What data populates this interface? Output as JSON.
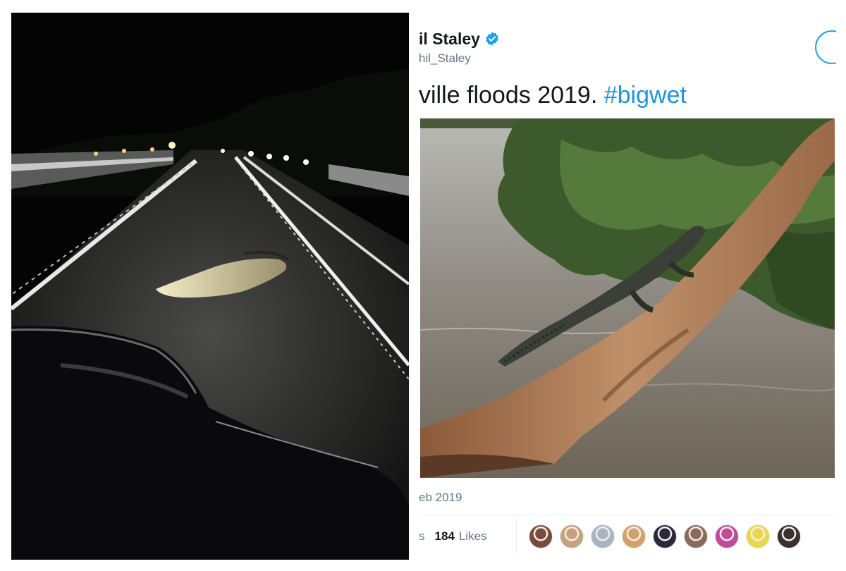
{
  "tweet": {
    "author_name": "il Staley",
    "handle": "hil_Staley",
    "text": "ville floods 2019. ",
    "hashtag": "#bigwet",
    "timestamp": "eb 2019",
    "stats_prefix": "s",
    "likes_count": "184",
    "likes_label": "Likes",
    "accent_color": "#1da1f2",
    "verified_icon": "verified-badge-icon",
    "liker_avatars": [
      {
        "color": "#7a4a3a"
      },
      {
        "color": "#c8a07a"
      },
      {
        "color": "#a9b4c2"
      },
      {
        "color": "#d4a06a"
      },
      {
        "color": "#2a2a3a"
      },
      {
        "color": "#8a6a5a"
      },
      {
        "color": "#c24a9a"
      },
      {
        "color": "#e8d84a"
      },
      {
        "color": "#3a3030"
      }
    ]
  }
}
